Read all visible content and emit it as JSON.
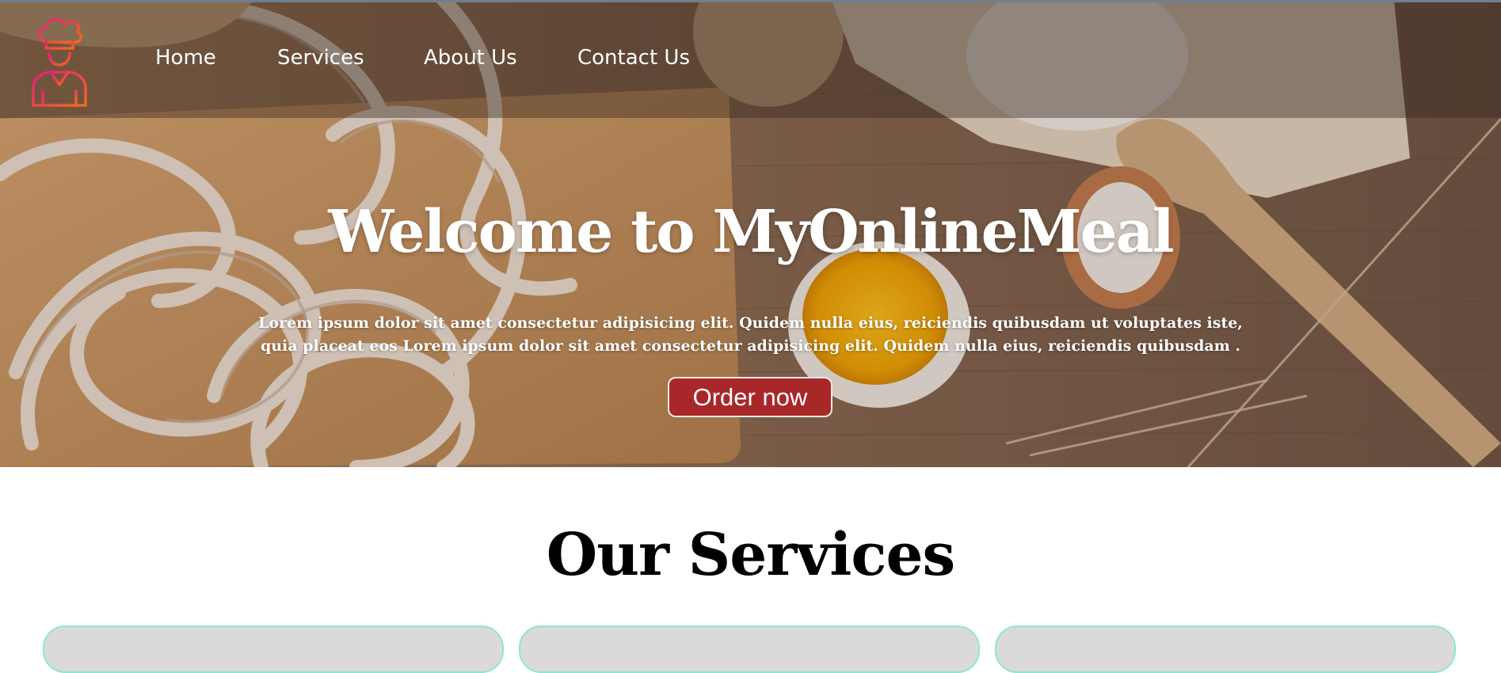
{
  "nav": {
    "logo_name": "chef-logo",
    "links": [
      "Home",
      "Services",
      "About Us",
      "Contact Us"
    ]
  },
  "hero": {
    "title": "Welcome to MyOnlineMeal",
    "description": "Lorem ipsum dolor sit amet consectetur adipisicing elit. Quidem nulla eius, reiciendis quibusdam ut voluptates iste, quia placeat eos Lorem ipsum dolor sit amet consectetur adipisicing elit. Quidem nulla eius, reiciendis quibusdam .",
    "button_label": "Order now"
  },
  "services": {
    "title": "Our Services",
    "cards": [
      {},
      {},
      {}
    ]
  },
  "colors": {
    "button_bg": "#a8282a",
    "card_bg": "#dcdad8",
    "card_border": "#8ee6cf",
    "logo_gradient_start": "#e0207a",
    "logo_gradient_end": "#f26b1d"
  }
}
